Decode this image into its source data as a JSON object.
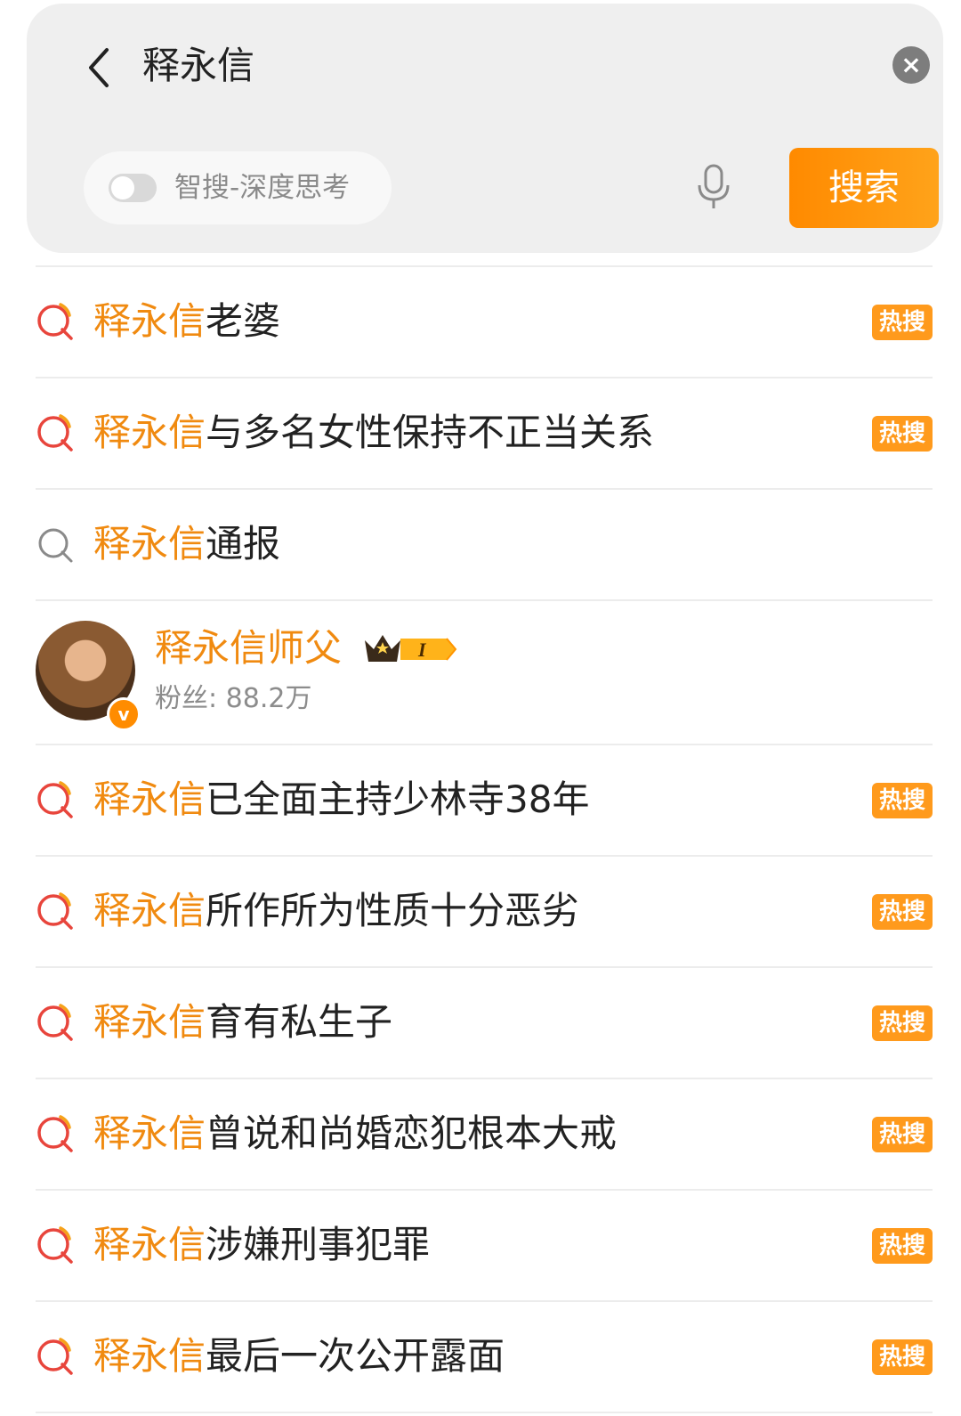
{
  "search": {
    "query": "释永信",
    "ai_toggle_label": "智搜-深度思考",
    "search_button_label": "搜索"
  },
  "user_card": {
    "name": "释永信师父",
    "followers_text": "粉丝: 88.2万",
    "level_badge": "I"
  },
  "suggestions": [
    {
      "highlight": "释永信",
      "rest": "老婆",
      "badge": "热搜",
      "icon": "hot-search-icon"
    },
    {
      "highlight": "释永信",
      "rest": "与多名女性保持不正当关系",
      "badge": "热搜",
      "icon": "hot-search-icon"
    },
    {
      "highlight": "释永信",
      "rest": "通报",
      "badge": "",
      "icon": "search-icon"
    },
    {
      "highlight": "释永信",
      "rest": "已全面主持少林寺38年",
      "badge": "热搜",
      "icon": "hot-search-icon"
    },
    {
      "highlight": "释永信",
      "rest": "所作所为性质十分恶劣",
      "badge": "热搜",
      "icon": "hot-search-icon"
    },
    {
      "highlight": "释永信",
      "rest": "育有私生子",
      "badge": "热搜",
      "icon": "hot-search-icon"
    },
    {
      "highlight": "释永信",
      "rest": "曾说和尚婚恋犯根本大戒",
      "badge": "热搜",
      "icon": "hot-search-icon"
    },
    {
      "highlight": "释永信",
      "rest": "涉嫌刑事犯罪",
      "badge": "热搜",
      "icon": "hot-search-icon"
    },
    {
      "highlight": "释永信",
      "rest": "最后一次公开露面",
      "badge": "热搜",
      "icon": "hot-search-icon"
    }
  ],
  "colors": {
    "accent": "#f08a10",
    "badge": "#ff9a1c",
    "hot_icon_red": "#e8453c"
  }
}
